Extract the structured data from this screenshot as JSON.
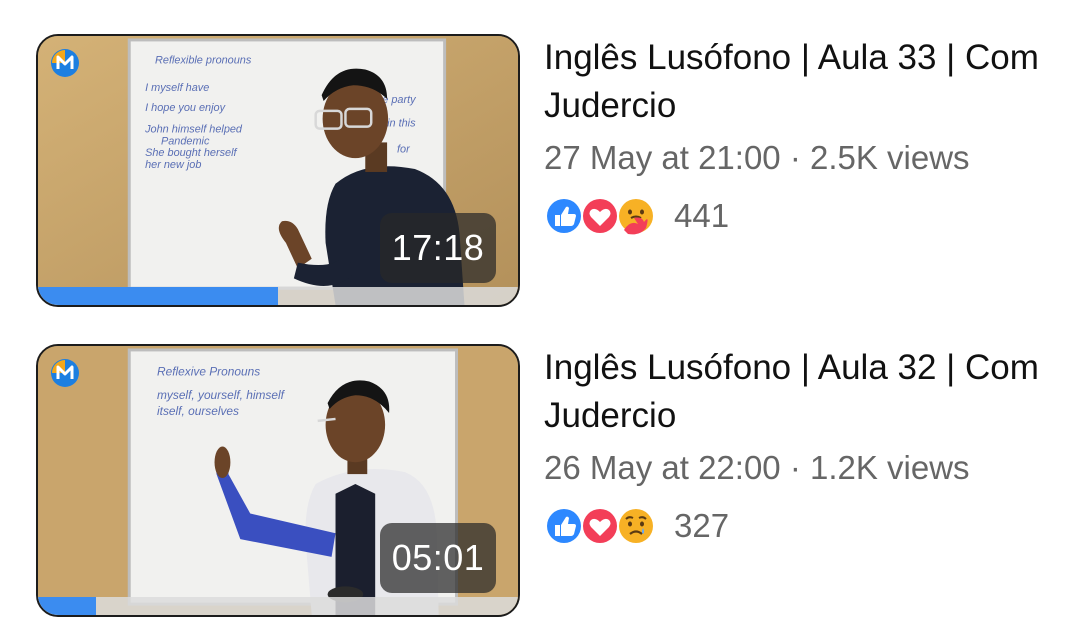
{
  "videos": [
    {
      "title": "Inglês Lusófono | Aula 33 | Com Judercio",
      "meta": "27 May at 21:00 · 2.5K views",
      "duration": "17:18",
      "progress": 0.5,
      "reaction_count": "441",
      "reactions": [
        "like-icon",
        "love-icon",
        "care-icon"
      ],
      "whiteboard_text": [
        "Reflexible pronouns",
        "I myself have",
        "I hope you enjoy",
        "John himself helped",
        "Pandemic",
        "She bought herself",
        "her new job",
        "the party",
        "in this",
        "for"
      ]
    },
    {
      "title": "Inglês Lusófono | Aula 32 | Com Judercio",
      "meta": "26 May at 22:00 · 1.2K views",
      "duration": "05:01",
      "progress": 0.12,
      "reaction_count": "327",
      "reactions": [
        "like-icon",
        "love-icon",
        "sad-icon"
      ],
      "whiteboard_text": [
        "Reflexive Pronouns",
        "myself, yourself, himself",
        "itself, ourselves"
      ]
    }
  ],
  "colors": {
    "like": "#2d88ff",
    "love": "#f33e58",
    "care": "#f7b125",
    "progress": "#3b8cf0",
    "channel_logo": "#1d7fe0"
  }
}
